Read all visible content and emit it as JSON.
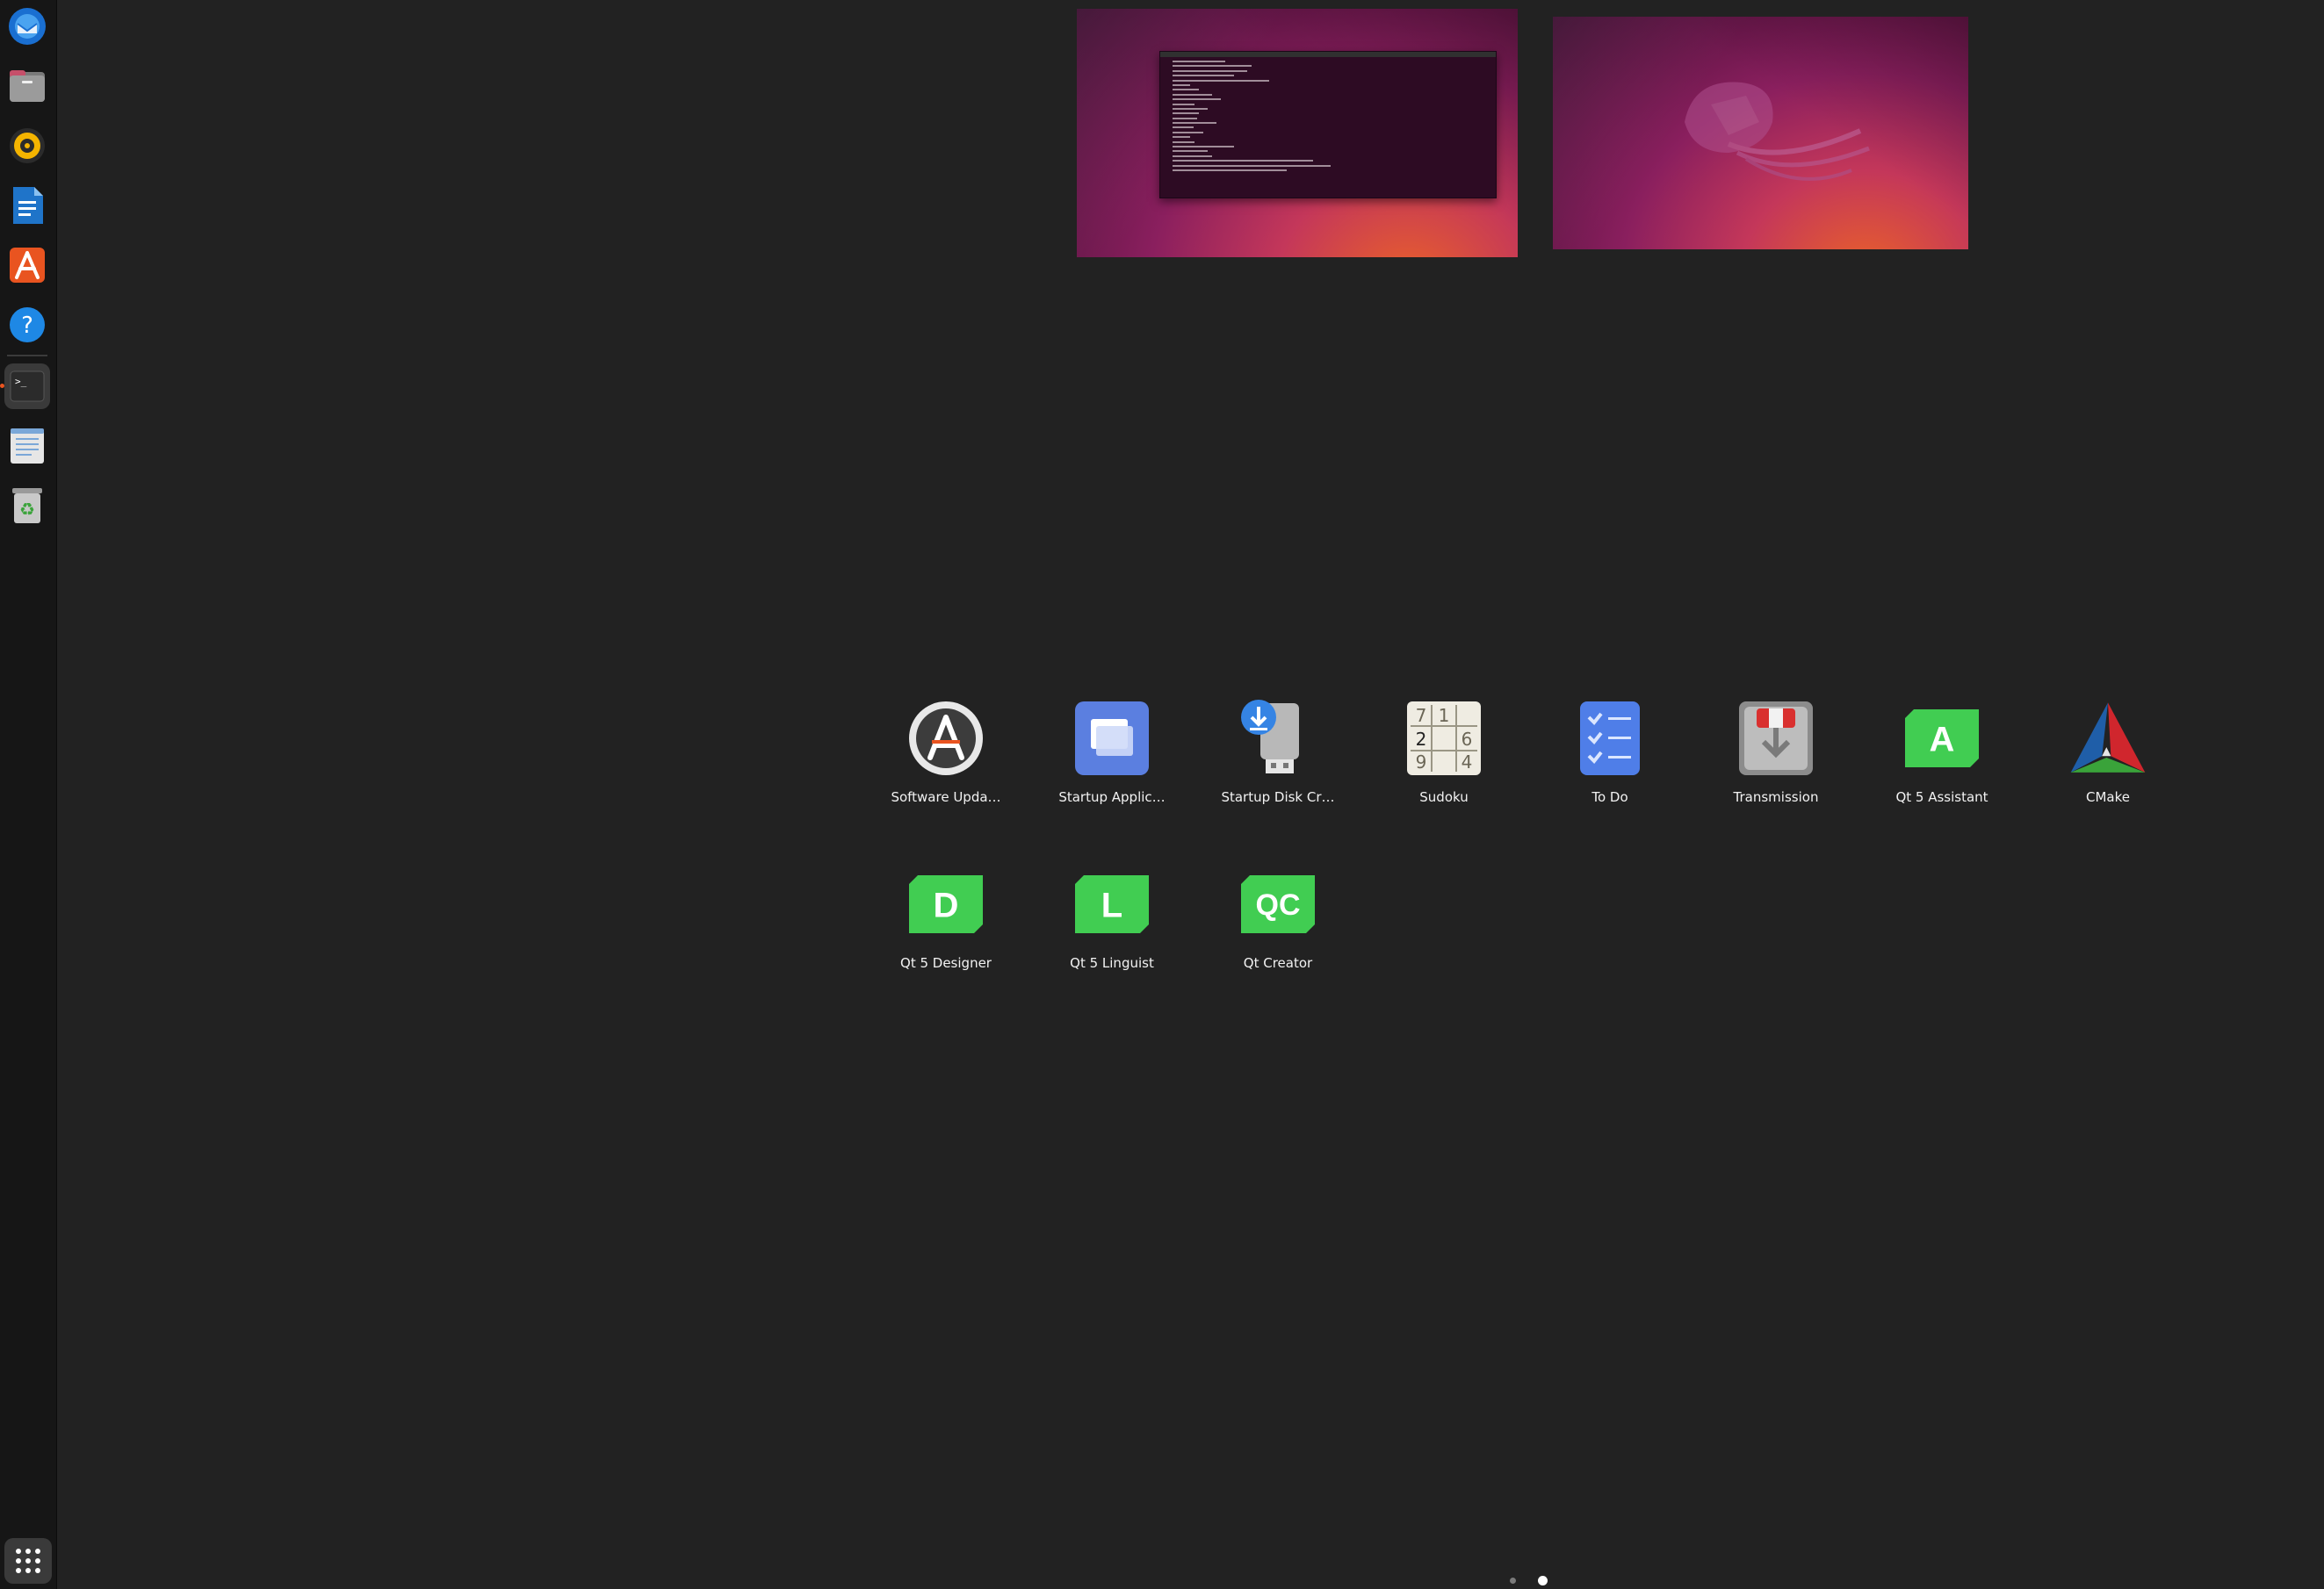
{
  "dock": {
    "items": [
      {
        "name": "thunderbird-icon"
      },
      {
        "name": "files-icon"
      },
      {
        "name": "rhythmbox-icon"
      },
      {
        "name": "libreoffice-writer-icon"
      },
      {
        "name": "app-center-icon"
      },
      {
        "name": "help-icon"
      },
      {
        "name": "terminal-icon",
        "running": true
      },
      {
        "name": "text-editor-icon"
      },
      {
        "name": "trash-icon"
      }
    ],
    "show_apps": "show-applications-icon"
  },
  "workspaces": [
    {
      "name": "workspace-1",
      "has_terminal": true
    },
    {
      "name": "workspace-2",
      "has_terminal": false
    }
  ],
  "apps": [
    {
      "label": "Software Upda…",
      "icon": "software-updater-icon"
    },
    {
      "label": "Startup Applic…",
      "icon": "startup-applications-icon"
    },
    {
      "label": "Startup Disk Cr…",
      "icon": "startup-disk-creator-icon"
    },
    {
      "label": "Sudoku",
      "icon": "sudoku-icon"
    },
    {
      "label": "To Do",
      "icon": "todo-icon"
    },
    {
      "label": "Transmission",
      "icon": "transmission-icon"
    },
    {
      "label": "Qt 5 Assistant",
      "icon": "qt-assistant-icon"
    },
    {
      "label": "CMake",
      "icon": "cmake-icon"
    },
    {
      "label": "Qt 5 Designer",
      "icon": "qt-designer-icon"
    },
    {
      "label": "Qt 5 Linguist",
      "icon": "qt-linguist-icon"
    },
    {
      "label": "Qt Creator",
      "icon": "qt-creator-icon"
    }
  ],
  "sudoku_digits": [
    "7",
    "1",
    "2",
    "6",
    "9",
    "4"
  ],
  "qt_letters": {
    "assistant": "A",
    "designer": "D",
    "linguist": "L",
    "creator": "QC"
  },
  "pagination": {
    "pages": 2,
    "current": 2
  },
  "colors": {
    "accent": "#e95420",
    "qt_green": "#41cd52",
    "background": "#222222"
  }
}
